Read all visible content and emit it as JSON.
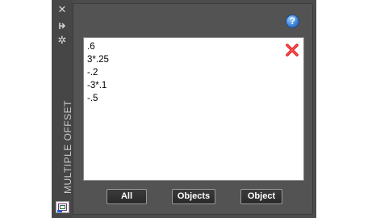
{
  "palette": {
    "title": "MULTIPLE OFFSET",
    "strip_icons": [
      "close-icon",
      "auto-hide-icon",
      "settings-icon"
    ]
  },
  "offset_list": {
    "lines": [
      ".6",
      "3*.25",
      "-.2",
      "-3*.1",
      "-.5"
    ]
  },
  "buttons": {
    "all_label": "All",
    "objects_label": "Objects",
    "object_label": "Object"
  },
  "help": {
    "glyph": "?"
  },
  "colors": {
    "panel_bg": "#4c4c4c",
    "inner_bg": "#535353",
    "text_bg": "#ffffff",
    "delete_red": "#e02020",
    "help_blue": "#3f86d8"
  }
}
